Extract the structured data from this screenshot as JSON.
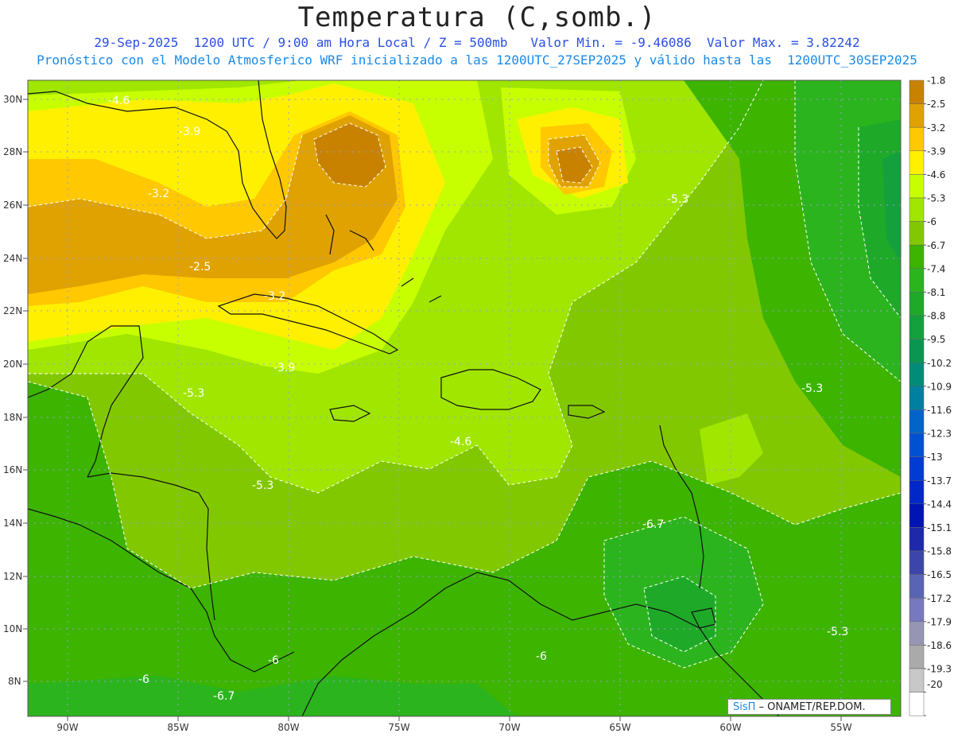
{
  "title": "Temperatura (C,somb.)",
  "subtitle1": "29-Sep-2025  1200 UTC / 9:00 am Hora Local / Z = 500mb   Valor Min. = -9.46086  Valor Max. = 3.82242",
  "subtitle2": "Pronóstico con el Modelo Atmosferico WRF inicializado a las 1200UTC_27SEP2025 y válido hasta las  1200UTC_30SEP2025",
  "axes": {
    "lat_labels": [
      "30N",
      "28N",
      "26N",
      "24N",
      "22N",
      "20N",
      "18N",
      "16N",
      "14N",
      "12N",
      "10N",
      "8N"
    ],
    "lon_labels": [
      "90W",
      "85W",
      "80W",
      "75W",
      "70W",
      "65W",
      "60W",
      "55W"
    ]
  },
  "colorbar": {
    "levels": [
      "-1.8",
      "-2.5",
      "-3.2",
      "-3.9",
      "-4.6",
      "-5.3",
      "-6",
      "-6.7",
      "-7.4",
      "-8.1",
      "-8.8",
      "-9.5",
      "-10.2",
      "-10.9",
      "-11.6",
      "-12.3",
      "-13",
      "-13.7",
      "-14.4",
      "-15.1",
      "-15.8",
      "-16.5",
      "-17.2",
      "-17.9",
      "-18.6",
      "-19.3",
      "-20"
    ],
    "colors": [
      "#c88200",
      "#e0a200",
      "#ffc800",
      "#fff000",
      "#c8ff00",
      "#a0e600",
      "#82c800",
      "#3cb400",
      "#2cb41e",
      "#1eaa28",
      "#14a03c",
      "#0a9650",
      "#008c78",
      "#0080a0",
      "#0064c8",
      "#0050d2",
      "#003cd2",
      "#0028c8",
      "#0014b4",
      "#1e28aa",
      "#3c46aa",
      "#5a64b4",
      "#7878be",
      "#9696b4",
      "#aaaaaa",
      "#c8c8c8",
      "#ffffff"
    ]
  },
  "contour_labels": [
    {
      "text": "-4.6"
    },
    {
      "text": "-3.9"
    },
    {
      "text": "-3.2"
    },
    {
      "text": "-2.5"
    },
    {
      "text": "-3.2"
    },
    {
      "text": "-5.3"
    },
    {
      "text": "-3.9"
    },
    {
      "text": "-5.3"
    },
    {
      "text": "-4.6"
    },
    {
      "text": "-5.3"
    },
    {
      "text": "-5.3"
    },
    {
      "text": "-6.7"
    },
    {
      "text": "-6"
    },
    {
      "text": "-6"
    },
    {
      "text": "-6.7"
    },
    {
      "text": "-6"
    },
    {
      "text": "-5.3"
    }
  ],
  "credit": {
    "brand": "SisΠ",
    "text": " – ONAMET/REP.DOM."
  }
}
